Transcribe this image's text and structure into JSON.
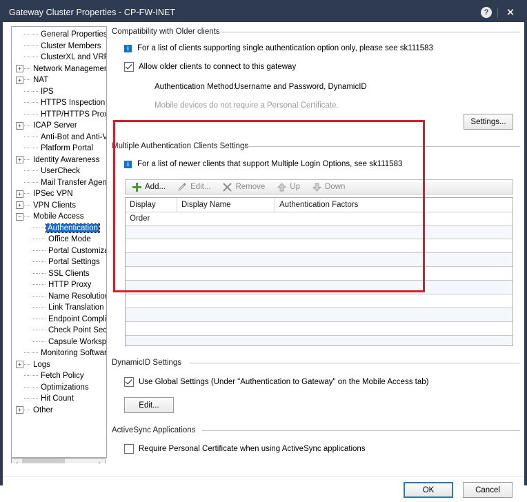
{
  "window": {
    "title": "Gateway Cluster Properties - CP-FW-INET",
    "help_icon": "?",
    "close_icon": "✕",
    "accent_color": "#2e3b51",
    "highlight_color": "#d42027"
  },
  "sidebar": {
    "scroll": {
      "left_arrow": "‹",
      "right_arrow": "›"
    },
    "items": [
      {
        "label": "General Properties",
        "indent": 1,
        "expander": "none"
      },
      {
        "label": "Cluster Members",
        "indent": 1,
        "expander": "none"
      },
      {
        "label": "ClusterXL and VRRP",
        "indent": 1,
        "expander": "none"
      },
      {
        "label": "Network Management",
        "indent": 0,
        "expander": "plus"
      },
      {
        "label": "NAT",
        "indent": 0,
        "expander": "plus"
      },
      {
        "label": "IPS",
        "indent": 1,
        "expander": "none"
      },
      {
        "label": "HTTPS Inspection",
        "indent": 1,
        "expander": "none"
      },
      {
        "label": "HTTP/HTTPS Proxy",
        "indent": 1,
        "expander": "none"
      },
      {
        "label": "ICAP Server",
        "indent": 0,
        "expander": "plus"
      },
      {
        "label": "Anti-Bot and Anti-Virus",
        "indent": 1,
        "expander": "none"
      },
      {
        "label": "Platform Portal",
        "indent": 1,
        "expander": "none"
      },
      {
        "label": "Identity Awareness",
        "indent": 0,
        "expander": "plus"
      },
      {
        "label": "UserCheck",
        "indent": 1,
        "expander": "none"
      },
      {
        "label": "Mail Transfer Agent",
        "indent": 1,
        "expander": "none"
      },
      {
        "label": "IPSec VPN",
        "indent": 0,
        "expander": "plus"
      },
      {
        "label": "VPN Clients",
        "indent": 0,
        "expander": "plus"
      },
      {
        "label": "Mobile Access",
        "indent": 0,
        "expander": "minus"
      },
      {
        "label": "Authentication",
        "indent": 2,
        "expander": "none",
        "selected": true
      },
      {
        "label": "Office Mode",
        "indent": 2,
        "expander": "none"
      },
      {
        "label": "Portal Customizatio",
        "indent": 2,
        "expander": "none"
      },
      {
        "label": "Portal Settings",
        "indent": 2,
        "expander": "none"
      },
      {
        "label": "SSL Clients",
        "indent": 2,
        "expander": "none"
      },
      {
        "label": "HTTP Proxy",
        "indent": 2,
        "expander": "none"
      },
      {
        "label": "Name Resolution",
        "indent": 2,
        "expander": "none"
      },
      {
        "label": "Link Translation",
        "indent": 2,
        "expander": "none"
      },
      {
        "label": "Endpoint Complian",
        "indent": 2,
        "expander": "none"
      },
      {
        "label": "Check Point Secur",
        "indent": 2,
        "expander": "none"
      },
      {
        "label": "Capsule Workspac",
        "indent": 2,
        "expander": "none"
      },
      {
        "label": "Monitoring Software bla",
        "indent": 1,
        "expander": "none"
      },
      {
        "label": "Logs",
        "indent": 0,
        "expander": "plus"
      },
      {
        "label": "Fetch Policy",
        "indent": 1,
        "expander": "none"
      },
      {
        "label": "Optimizations",
        "indent": 1,
        "expander": "none"
      },
      {
        "label": "Hit Count",
        "indent": 1,
        "expander": "none"
      },
      {
        "label": "Other",
        "indent": 0,
        "expander": "plus"
      }
    ]
  },
  "compatibility": {
    "group_title": "Compatibility with Older clients",
    "info_icon": "i",
    "info_text": "For a list of clients supporting single authentication option only, please see sk111583",
    "allow_older_label": "Allow older clients to connect to this gateway",
    "allow_older_checked": true,
    "auth_method_key": "Authentication Method:",
    "auth_method_value": "Username and Password, DynamicID",
    "note": "Mobile devices do not require a Personal Certificate.",
    "settings_button": "Settings..."
  },
  "multi_auth": {
    "group_title": "Multiple Authentication Clients Settings",
    "info_icon": "i",
    "info_text": "For a list of newer clients that support Multiple Login Options, see sk111583",
    "toolbar": [
      {
        "label": "Add...",
        "icon": "plus-icon",
        "enabled": true
      },
      {
        "label": "Edit...",
        "icon": "pencil-icon",
        "enabled": false
      },
      {
        "label": "Remove",
        "icon": "cross-icon",
        "enabled": false
      },
      {
        "label": "Up",
        "icon": "arrow-up-icon",
        "enabled": false
      },
      {
        "label": "Down",
        "icon": "arrow-down-icon",
        "enabled": false
      }
    ],
    "table": {
      "columns": [
        "Display Order",
        "Display Name",
        "Authentication Factors"
      ],
      "rows": []
    }
  },
  "dynamicid": {
    "group_title": "DynamicID Settings",
    "use_global_label": "Use Global Settings (Under \"Authentication to Gateway\" on the Mobile Access tab)",
    "use_global_checked": true,
    "edit_button": "Edit..."
  },
  "activesync": {
    "group_title": "ActiveSync Applications",
    "require_cert_label": "Require Personal Certificate when using ActiveSync applications",
    "require_cert_checked": false
  },
  "footer": {
    "ok_label": "OK",
    "cancel_label": "Cancel"
  }
}
